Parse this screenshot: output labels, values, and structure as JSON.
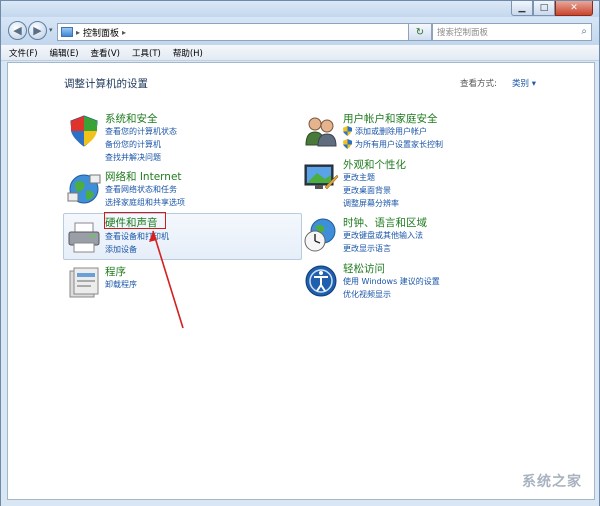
{
  "window": {
    "search_placeholder": "搜索控制面板",
    "breadcrumb": "控制面板"
  },
  "menu": [
    "文件(F)",
    "编辑(E)",
    "查看(V)",
    "工具(T)",
    "帮助(H)"
  ],
  "page": {
    "title": "调整计算机的设置",
    "view_by_label": "查看方式:",
    "view_by_value": "类别 ▾"
  },
  "categories": {
    "system": {
      "title": "系统和安全",
      "links": [
        "查看您的计算机状态",
        "备份您的计算机",
        "查找并解决问题"
      ]
    },
    "network": {
      "title": "网络和 Internet",
      "links": [
        "查看网络状态和任务",
        "选择家庭组和共享选项"
      ]
    },
    "hardware": {
      "title": "硬件和声音",
      "links": [
        "查看设备和打印机",
        "添加设备"
      ]
    },
    "programs": {
      "title": "程序",
      "links": [
        "卸载程序"
      ]
    },
    "users": {
      "title": "用户帐户和家庭安全",
      "links": [
        "添加或删除用户帐户",
        "为所有用户设置家长控制"
      ]
    },
    "appearance": {
      "title": "外观和个性化",
      "links": [
        "更改主题",
        "更改桌面背景",
        "调整屏幕分辨率"
      ]
    },
    "clock": {
      "title": "时钟、语言和区域",
      "links": [
        "更改键盘或其他输入法",
        "更改显示语言"
      ]
    },
    "ease": {
      "title": "轻松访问",
      "links": [
        "使用 Windows 建议的设置",
        "优化视频显示"
      ]
    }
  },
  "watermark": "系统之家"
}
